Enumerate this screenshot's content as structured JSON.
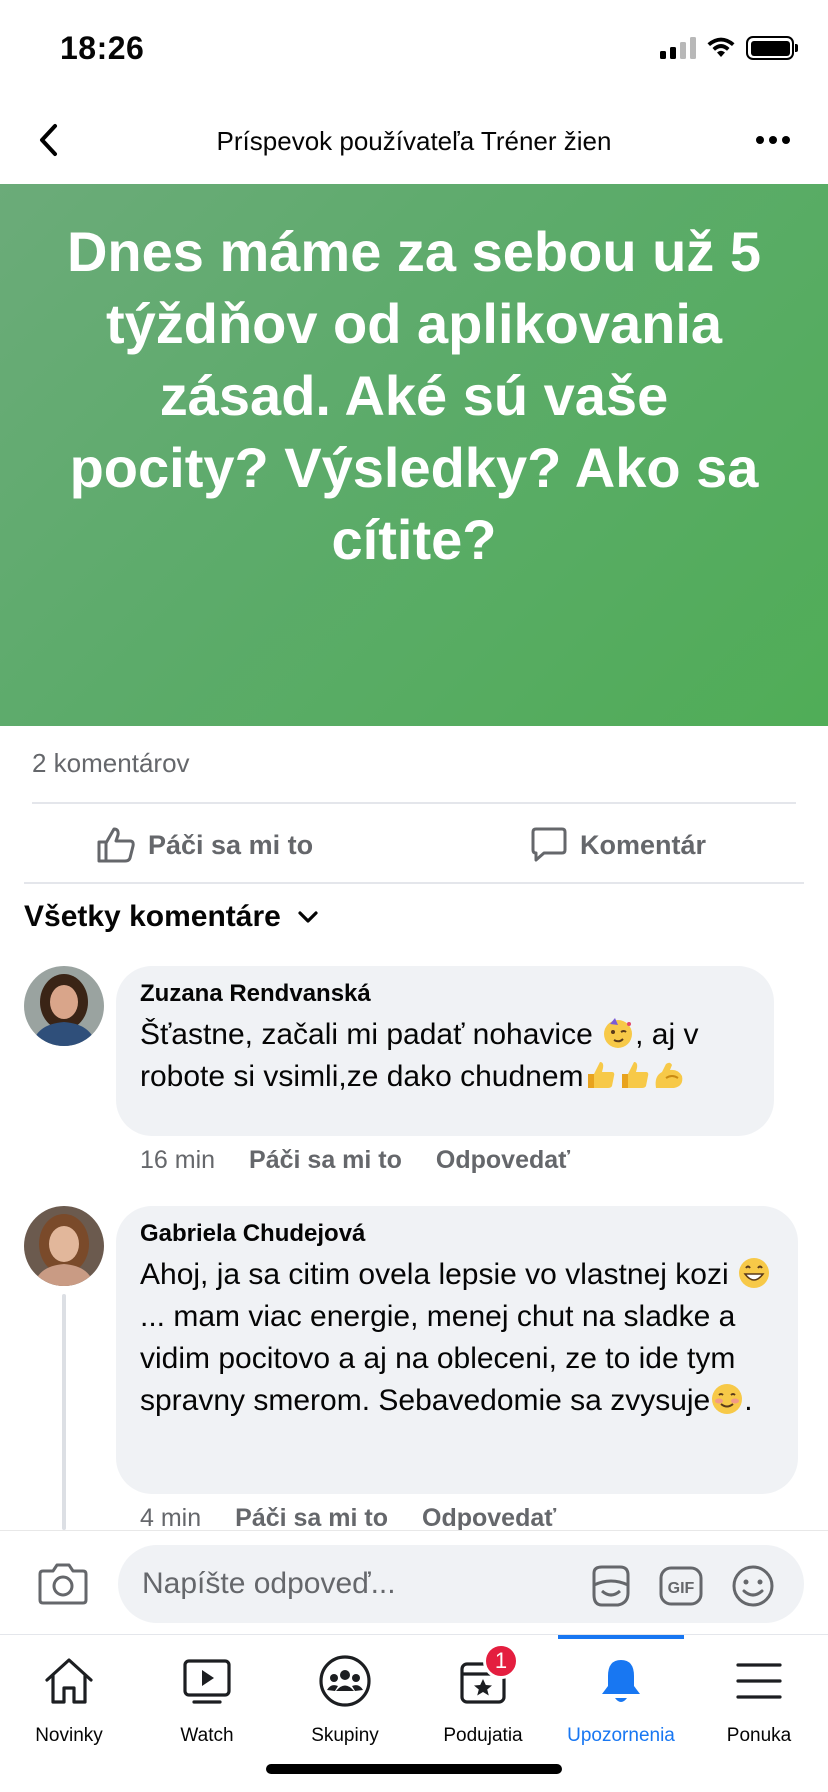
{
  "status_bar": {
    "time": "18:26"
  },
  "header": {
    "title": "Príspevok používateľa Tréner žien"
  },
  "post": {
    "text": "Dnes máme za sebou už 5 týždňov od aplikovania zásad. Aké sú vaše pocity? Výsledky? Ako sa cítite?",
    "background_color": "#5bab64",
    "comment_count": "2 komentárov"
  },
  "actions": {
    "like": "Páči sa mi to",
    "comment": "Komentár"
  },
  "comments_filter": {
    "label": "Všetky komentáre"
  },
  "comments": [
    {
      "author": "Zuzana Rendvanská",
      "text_1": "Šťastne, začali mi padať nohavice ",
      "text_2": ", aj v robote si vsimli,ze dako chudnem",
      "time": "16 min",
      "like": "Páči sa mi to",
      "reply": "Odpovedať"
    },
    {
      "author": "Gabriela Chudejová",
      "text_1": "Ahoj, ja sa citim ovela lepsie vo vlastnej kozi ",
      "text_2": "... mam viac energie, menej chut na sladke a vidim pocitovo a aj na obleceni, ze to ide tym spravny smerom. Sebavedomie sa zvysuje",
      "text_3": ".",
      "time": "4 min",
      "like": "Páči sa mi to",
      "reply": "Odpovedať"
    }
  ],
  "composer": {
    "placeholder": "Napíšte odpoveď..."
  },
  "tabs": [
    {
      "label": "Novinky",
      "icon": "home-icon"
    },
    {
      "label": "Watch",
      "icon": "watch-icon"
    },
    {
      "label": "Skupiny",
      "icon": "groups-icon"
    },
    {
      "label": "Podujatia",
      "icon": "events-icon",
      "badge": "1"
    },
    {
      "label": "Upozornenia",
      "icon": "bell-icon",
      "active": true
    },
    {
      "label": "Ponuka",
      "icon": "menu-icon"
    }
  ],
  "colors": {
    "accent": "#1877f2",
    "badge": "#e41e3f",
    "muted_text": "#65676b",
    "bubble": "#f0f2f5"
  }
}
